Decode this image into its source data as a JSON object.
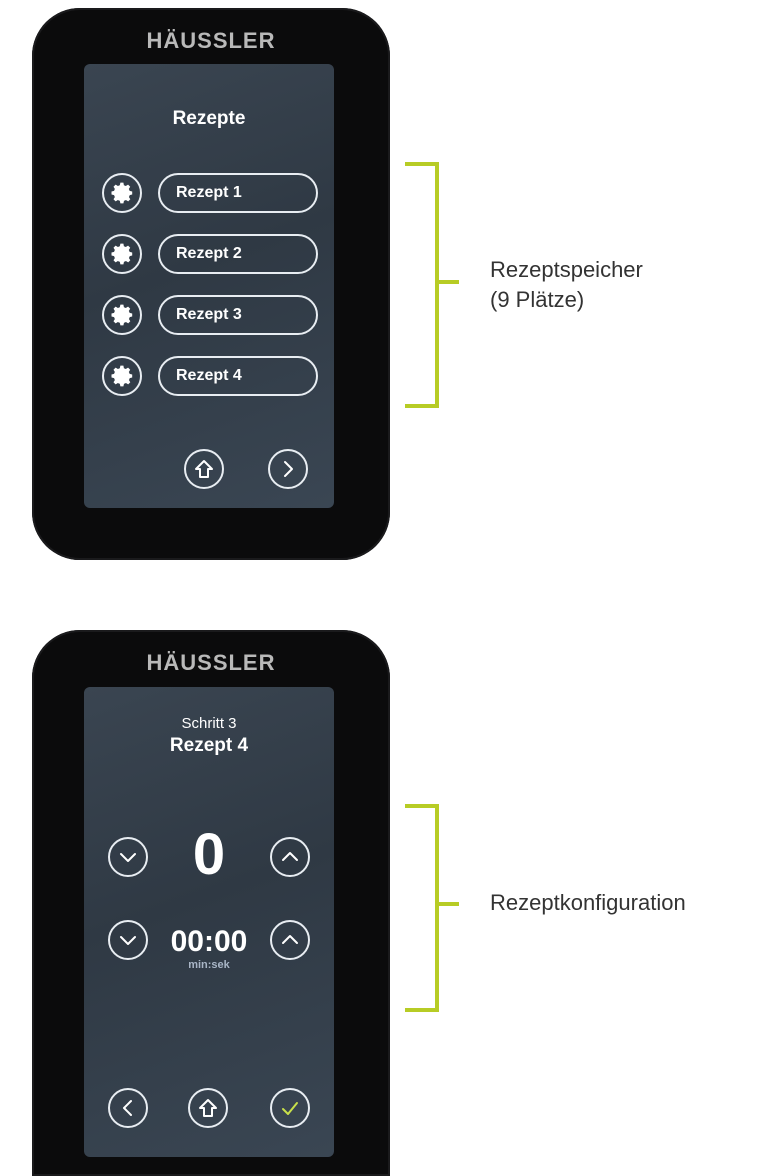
{
  "recipe_list": {
    "brand": "HÄUSSLER",
    "title": "Rezepte",
    "items": [
      {
        "label": "Rezept 1"
      },
      {
        "label": "Rezept 2"
      },
      {
        "label": "Rezept 3"
      },
      {
        "label": "Rezept 4"
      }
    ]
  },
  "recipe_config": {
    "brand": "HÄUSSLER",
    "step": "Schritt 3",
    "recipe": "Rezept 4",
    "value": "0",
    "time": "00:00",
    "time_unit": "min:sek"
  },
  "callouts": {
    "storage_line1": "Rezeptspeicher",
    "storage_line2": "(9 Plätze)",
    "config": "Rezeptkonfiguration"
  },
  "colors": {
    "accent": "#b7cc25",
    "confirm": "#c8e04a",
    "device": "#0b0b0c",
    "screen": "#34404c"
  },
  "icons": [
    "gear-icon",
    "home-icon",
    "chevron-right-icon",
    "chevron-left-icon",
    "chevron-up-icon",
    "chevron-down-icon",
    "check-icon"
  ]
}
